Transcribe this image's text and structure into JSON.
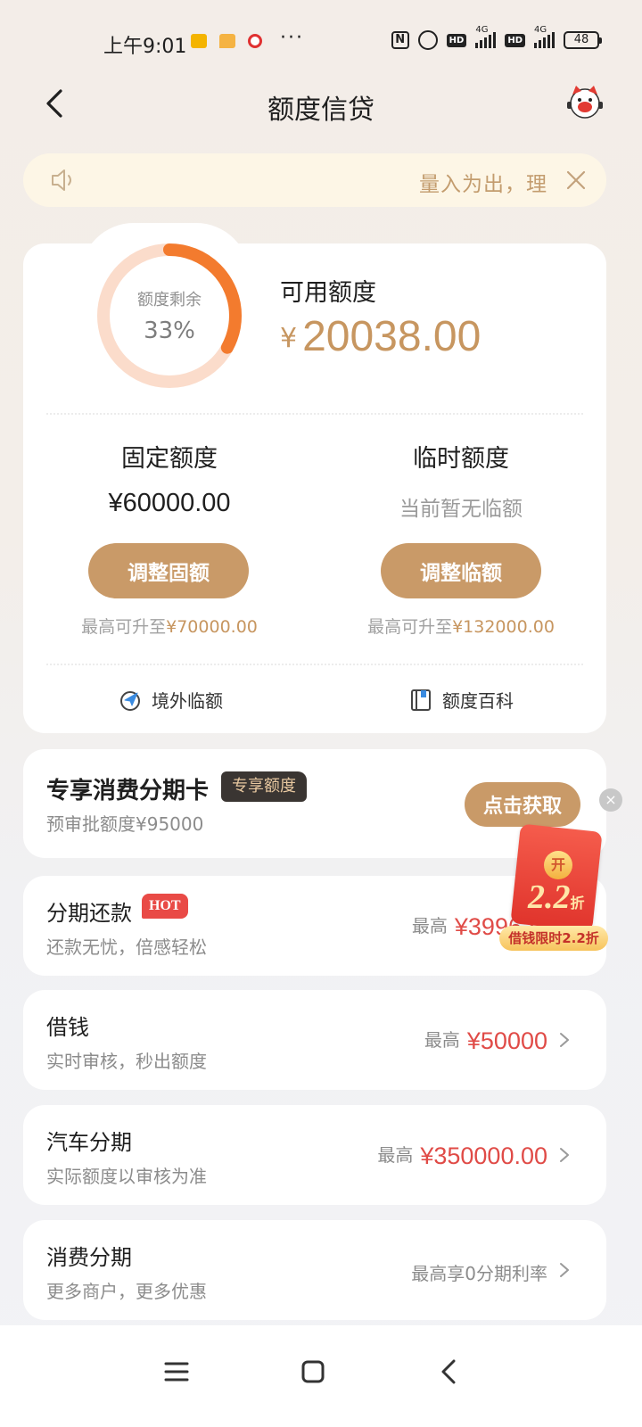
{
  "status_bar": {
    "time": "上午9:01",
    "dots": "···",
    "hd1": "HD",
    "net1": "4G",
    "hd2": "HD",
    "net2": "4G",
    "battery": "48"
  },
  "header": {
    "title": "额度信贷"
  },
  "notice": {
    "text": "量入为出，理"
  },
  "quota": {
    "ring_label": "额度剩余",
    "ring_percent": "33%",
    "ring_fraction": 0.33,
    "available_label": "可用额度",
    "currency": "¥",
    "available_amount": "20038.00",
    "fixed": {
      "title": "固定额度",
      "value": "¥60000.00",
      "button": "调整固额",
      "max_prefix": "最高可升至",
      "max_value": "¥70000.00"
    },
    "temp": {
      "title": "临时额度",
      "value": "当前暂无临额",
      "button": "调整临额",
      "max_prefix": "最高可升至",
      "max_value": "¥132000.00"
    },
    "tools": {
      "overseas": "境外临额",
      "wiki": "额度百科"
    }
  },
  "exclusive": {
    "title": "专享消费分期卡",
    "tag": "专享额度",
    "subtitle": "预审批额度¥95000",
    "button": "点击获取",
    "close": "×"
  },
  "promo": {
    "coin": "开",
    "rate": "2.2",
    "rate_unit": "折",
    "ribbon": "借钱限时2.2折"
  },
  "products": [
    {
      "title": "分期还款",
      "tag": "HOT",
      "subtitle": "还款无忧，倍感轻松",
      "prefix": "最高",
      "amount": "¥3996?"
    },
    {
      "title": "借钱",
      "subtitle": "实时审核，秒出额度",
      "prefix": "最高",
      "amount": "¥50000"
    },
    {
      "title": "汽车分期",
      "subtitle": "实际额度以审核为准",
      "prefix": "最高",
      "amount": "¥350000.00"
    },
    {
      "title": "消费分期",
      "subtitle": "更多商户，更多优惠",
      "plain": "最高享0分期利率"
    }
  ],
  "colors": {
    "accent": "#c99a68",
    "amount_gold": "#c79660",
    "amount_red": "#e04b47",
    "ring_active": "#f37b2e",
    "ring_track": "#fbdccb"
  },
  "icons": {
    "back": "chevron-left-icon",
    "mascot": "mascot-icon",
    "speaker": "speaker-icon",
    "close": "close-icon",
    "overseas": "plane-globe-icon",
    "wiki": "book-icon",
    "chevron": "chevron-right-icon"
  }
}
